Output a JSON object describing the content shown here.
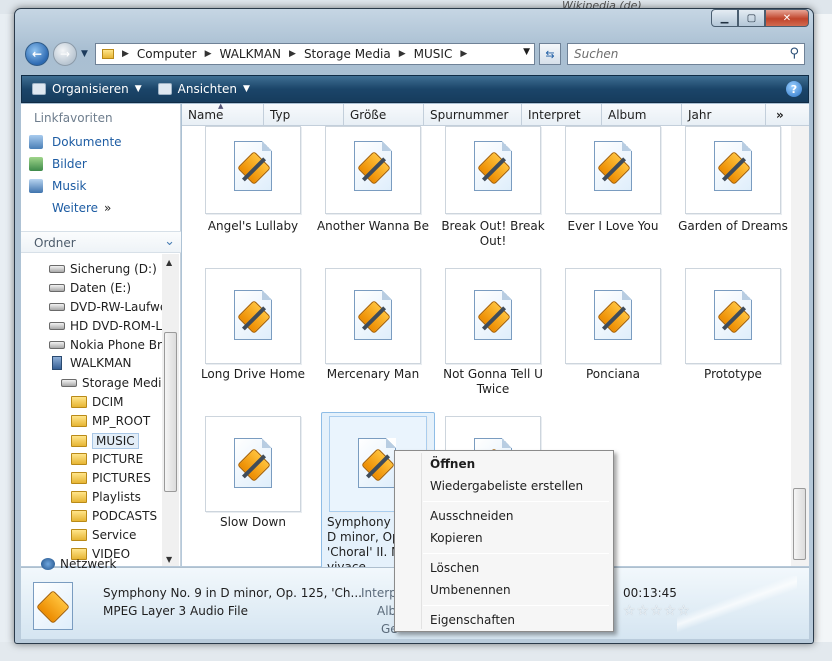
{
  "window": {
    "address": [
      "Computer",
      "WALKMAN",
      "Storage Media",
      "MUSIC"
    ],
    "search_placeholder": "Suchen"
  },
  "background": {
    "browser_tab": "Wikipedia (de)"
  },
  "commandbar": {
    "organize": "Organisieren",
    "views": "Ansichten",
    "help": "?"
  },
  "navpane": {
    "favorites_heading": "Linkfavoriten",
    "favorites": [
      "Dokumente",
      "Bilder",
      "Musik"
    ],
    "more": "Weitere",
    "folders_heading": "Ordner",
    "tree": [
      {
        "label": "Sicherung (D:)",
        "icon": "drive-icon"
      },
      {
        "label": "Daten (E:)",
        "icon": "drive-icon"
      },
      {
        "label": "DVD-RW-Laufwe",
        "icon": "drive-icon"
      },
      {
        "label": "HD DVD-ROM-L",
        "icon": "drive-icon"
      },
      {
        "label": "Nokia Phone Bro",
        "icon": "drive-icon"
      },
      {
        "label": "WALKMAN",
        "icon": "phone-icon"
      },
      {
        "label": "Storage Media",
        "icon": "drive-icon"
      },
      {
        "label": "DCIM",
        "icon": "folder-icon"
      },
      {
        "label": "MP_ROOT",
        "icon": "folder-icon"
      },
      {
        "label": "MUSIC",
        "icon": "folder-icon"
      },
      {
        "label": "PICTURE",
        "icon": "folder-icon"
      },
      {
        "label": "PICTURES",
        "icon": "folder-icon"
      },
      {
        "label": "Playlists",
        "icon": "folder-icon"
      },
      {
        "label": "PODCASTS",
        "icon": "folder-icon"
      },
      {
        "label": "Service",
        "icon": "folder-icon"
      },
      {
        "label": "VIDEO",
        "icon": "folder-icon"
      },
      {
        "label": "Netzwerk",
        "icon": "network-icon"
      }
    ]
  },
  "columns": [
    "Name",
    "Typ",
    "Größe",
    "Spurnummer",
    "Interpret",
    "Album",
    "Jahr",
    "»"
  ],
  "files": [
    {
      "label": "Angel's Lullaby"
    },
    {
      "label": "Another Wanna Be"
    },
    {
      "label": "Break Out! Break Out!"
    },
    {
      "label": "Ever I Love You"
    },
    {
      "label": "Garden of Dreams"
    },
    {
      "label": "Long Drive Home"
    },
    {
      "label": "Mercenary Man"
    },
    {
      "label": "Not Gonna Tell U Twice"
    },
    {
      "label": "Ponciana"
    },
    {
      "label": "Prototype"
    },
    {
      "label": "Slow Down"
    },
    {
      "label": "Symphony No. 9 in D minor, Op. 125, 'Choral' II. Molto vivace",
      "display": "Symphony No.\nD minor, Op. 1\n'Choral' II. Mol\nvivace",
      "selected": true
    },
    {
      "label": ""
    }
  ],
  "details": {
    "title": "Symphony No. 9 in D minor, Op. 125, 'Ch...",
    "type": "MPEG Layer 3 Audio File",
    "label_interpret": "Interpre",
    "label_album": "Albi",
    "label_genre": "Ge",
    "duration": "00:13:45",
    "rating": "☆☆☆☆☆"
  },
  "context_menu": {
    "open": "Öffnen",
    "create_playlist": "Wiedergabeliste erstellen",
    "cut": "Ausschneiden",
    "copy": "Kopieren",
    "delete": "Löschen",
    "rename": "Umbenennen",
    "properties": "Eigenschaften"
  }
}
